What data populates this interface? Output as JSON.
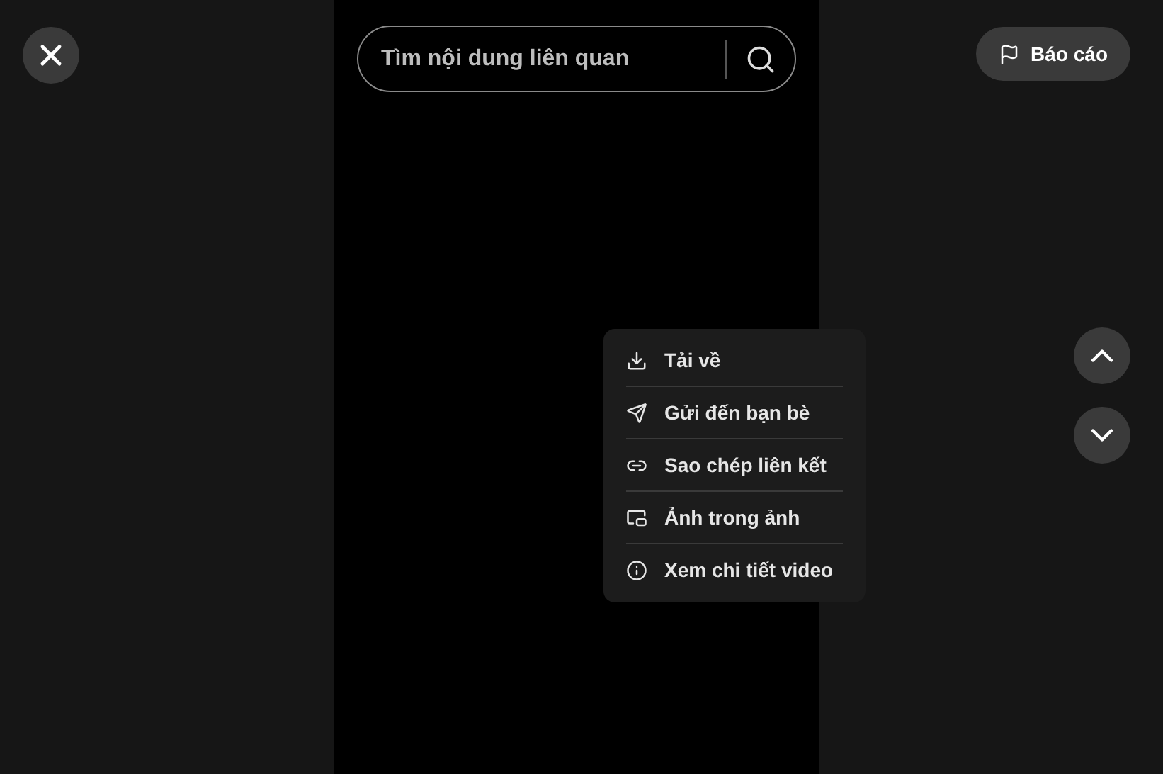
{
  "search": {
    "placeholder": "Tìm nội dung liên quan"
  },
  "report_button": {
    "label": "Báo cáo"
  },
  "menu": {
    "items": [
      {
        "label": "Tải về"
      },
      {
        "label": "Gửi đến bạn bè"
      },
      {
        "label": "Sao chép liên kết"
      },
      {
        "label": "Ảnh trong ảnh"
      },
      {
        "label": "Xem chi tiết video"
      }
    ]
  }
}
